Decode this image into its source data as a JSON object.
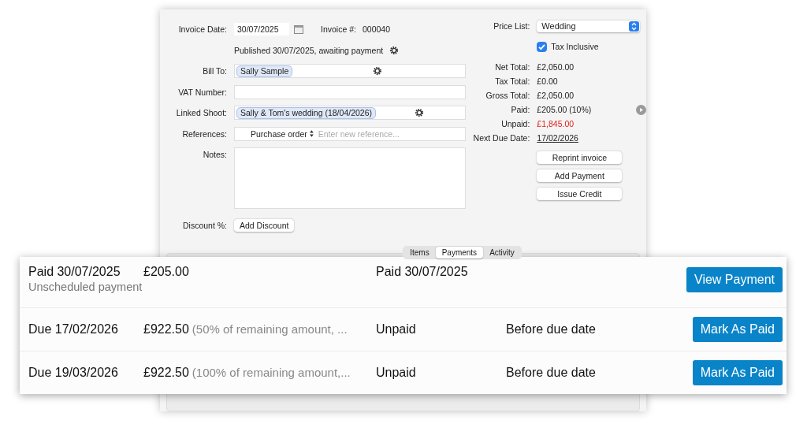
{
  "invoice": {
    "date_label": "Invoice Date:",
    "date": "30/07/2025",
    "number_label": "Invoice #:",
    "number": "000040",
    "status": "Published 30/07/2025, awaiting payment"
  },
  "fields": [
    {
      "label": "Bill To:",
      "kind": "token",
      "value": "Sally Sample"
    },
    {
      "label": "VAT Number:",
      "kind": "text"
    },
    {
      "label": "Linked Shoot:",
      "kind": "token",
      "value": "Sally & Tom's wedding (18/04/2026)"
    },
    {
      "label": "References:",
      "kind": "reference",
      "type": "Purchase order",
      "placeholder": "Enter new reference..."
    },
    {
      "label": "Notes:",
      "kind": "textarea"
    },
    {
      "label": "Discount %:",
      "kind": "button",
      "button": "Add Discount"
    }
  ],
  "price_list": {
    "label": "Price List:",
    "value": "Wedding"
  },
  "tax_inclusive": {
    "label": "Tax Inclusive",
    "checked": true
  },
  "totals": [
    {
      "label": "Net Total:",
      "value": "£2,050.00",
      "kind": "plain"
    },
    {
      "label": "Tax Total:",
      "value": "£0.00",
      "kind": "plain"
    },
    {
      "label": "Gross Total:",
      "value": "£2,050.00",
      "kind": "plain"
    },
    {
      "label": "Paid:",
      "value": "£205.00 (10%)",
      "kind": "action"
    },
    {
      "label": "Unpaid:",
      "value": "£1,845.00",
      "kind": "alert"
    },
    {
      "label": "Next Due Date:",
      "value": "17/02/2026",
      "kind": "link"
    }
  ],
  "actions": [
    "Reprint invoice",
    "Add Payment",
    "Issue Credit"
  ],
  "tabs": [
    {
      "label": "Items",
      "selected": false
    },
    {
      "label": "Payments",
      "selected": true
    },
    {
      "label": "Activity",
      "selected": false
    }
  ],
  "payments": [
    {
      "kind": "paid",
      "date": "Paid 30/07/2025",
      "amount": "£205.00",
      "note": "Unscheduled payment",
      "status": "Paid 30/07/2025",
      "button": "View Payment"
    },
    {
      "kind": "due",
      "date": "Due 17/02/2026",
      "amount": "£922.50",
      "note": "(50% of remaining amount, ...",
      "status": "Unpaid",
      "timing": "Before due date",
      "button": "Mark As Paid"
    },
    {
      "kind": "due",
      "date": "Due 19/03/2026",
      "amount": "£922.50",
      "note": "(100% of remaining amount,...",
      "status": "Unpaid",
      "timing": "Before due date",
      "button": "Mark As Paid"
    }
  ]
}
